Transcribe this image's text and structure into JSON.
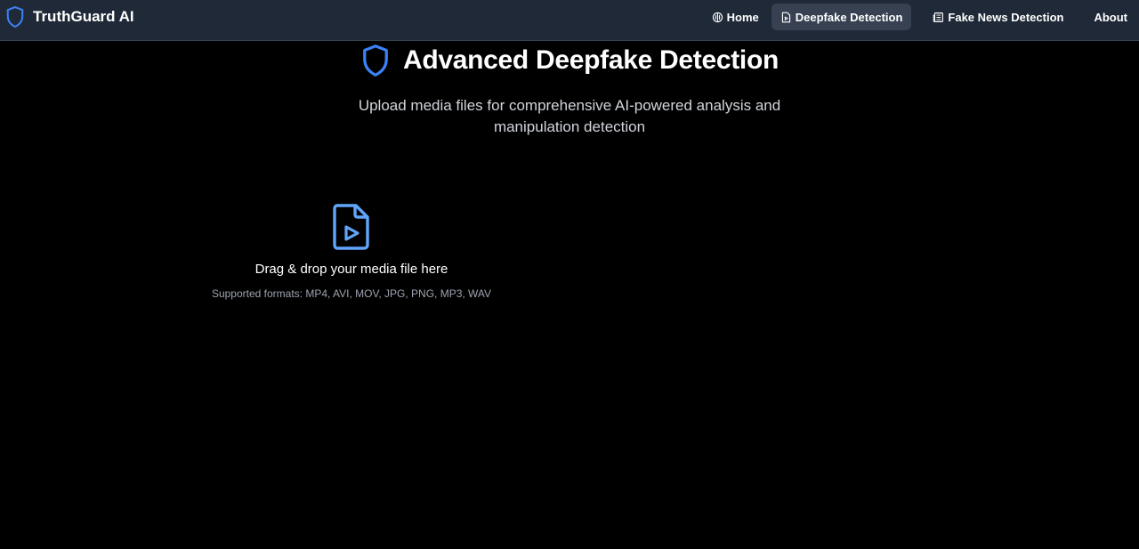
{
  "brand": {
    "name": "TruthGuard AI",
    "icon": "shield-icon"
  },
  "nav": {
    "items": [
      {
        "label": "Home",
        "icon": "brain-icon",
        "active": false
      },
      {
        "label": "Deepfake Detection",
        "icon": "file-video-icon",
        "active": true
      },
      {
        "label": "Fake News Detection",
        "icon": "newspaper-icon",
        "active": false
      },
      {
        "label": "About",
        "icon": "",
        "active": false
      }
    ]
  },
  "hero": {
    "title": "Advanced Deepfake Detection",
    "subtitle": "Upload media files for comprehensive AI-powered analysis and manipulation detection",
    "icon": "shield-icon"
  },
  "upload": {
    "icon": "file-video-icon",
    "title": "Drag & drop your media file here",
    "formats": "Supported formats: MP4, AVI, MOV, JPG, PNG, MP3, WAV"
  },
  "colors": {
    "accent": "#3b82f6",
    "navbar_bg": "#1f2937",
    "active_nav_bg": "#374151",
    "page_bg": "#000000",
    "muted_text": "#9ca3af"
  }
}
